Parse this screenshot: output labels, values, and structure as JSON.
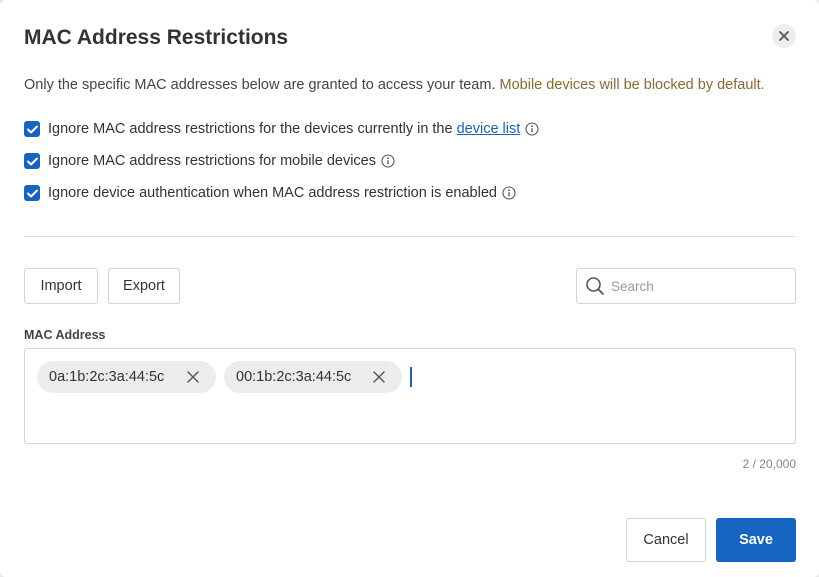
{
  "dialog": {
    "title": "MAC Address Restrictions",
    "description": "Only the specific MAC addresses below are granted to access your team.",
    "description_warning": "Mobile devices will be blocked by default."
  },
  "options": [
    {
      "label": "Ignore MAC address restrictions for the devices currently in the",
      "link": "device list",
      "checked": true
    },
    {
      "label": "Ignore MAC address restrictions for mobile devices",
      "checked": true
    },
    {
      "label": "Ignore device authentication when MAC address restriction is enabled",
      "checked": true
    }
  ],
  "toolbar": {
    "import_label": "Import",
    "export_label": "Export",
    "search_placeholder": "Search"
  },
  "mac_field": {
    "label": "MAC Address",
    "tags": [
      "0a:1b:2c:3a:44:5c",
      "00:1b:2c:3a:44:5c"
    ],
    "counter": "2 / 20,000"
  },
  "footer": {
    "cancel_label": "Cancel",
    "save_label": "Save"
  },
  "colors": {
    "accent": "#1565c0",
    "warning_text": "#8a6a2f"
  },
  "icons": {
    "close": "close-icon",
    "check": "check-icon",
    "info": "info-icon",
    "search": "search-icon",
    "tag_remove": "close-icon"
  }
}
